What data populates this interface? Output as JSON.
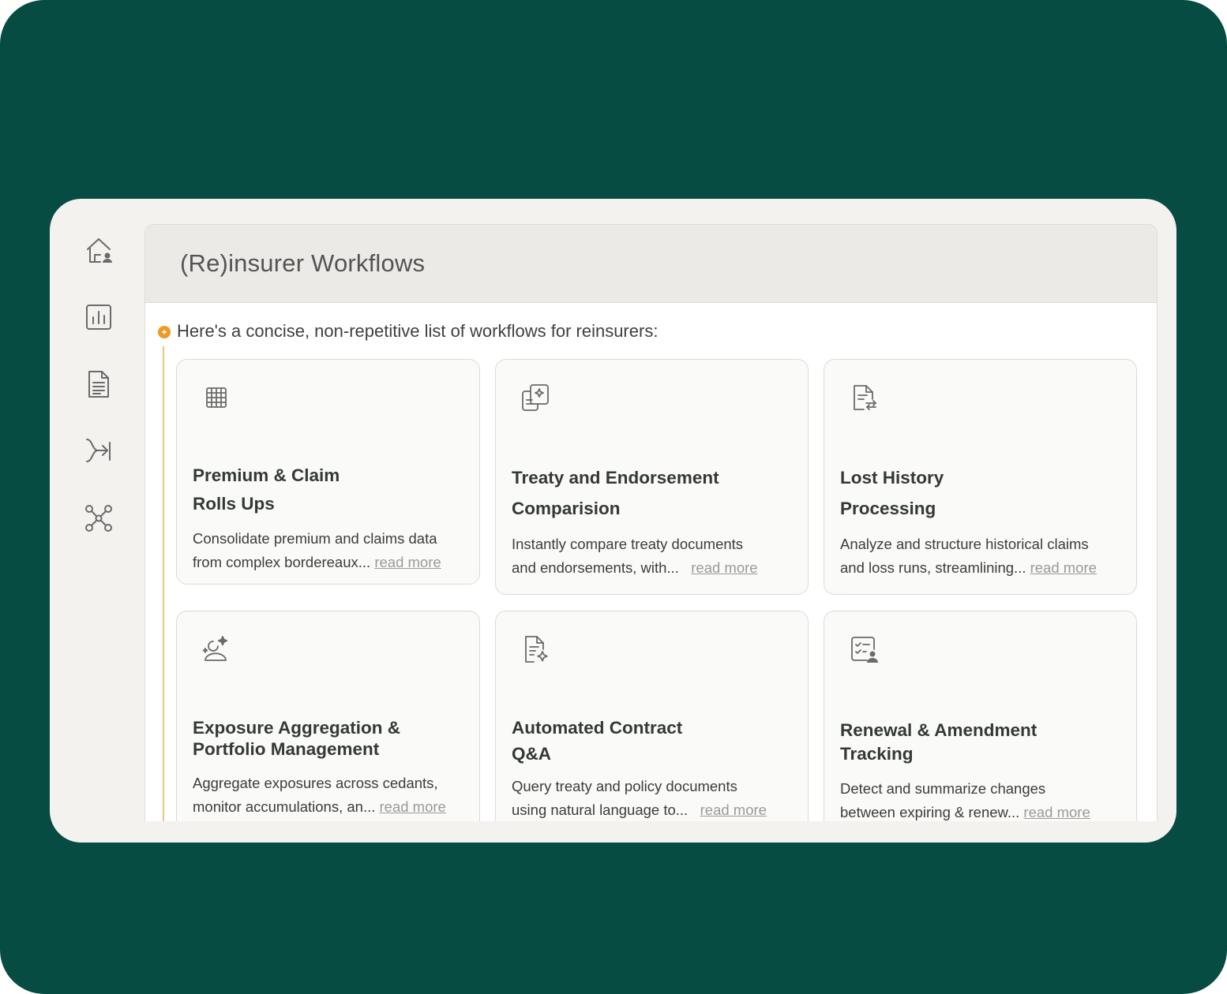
{
  "sidebar": {
    "items": [
      {
        "icon": "home-user-icon"
      },
      {
        "icon": "bar-chart-icon"
      },
      {
        "icon": "document-icon"
      },
      {
        "icon": "route-arrow-icon"
      },
      {
        "icon": "network-icon"
      }
    ]
  },
  "header": {
    "title": "(Re)insurer Workflows"
  },
  "intro": {
    "text": "Here's a concise, non-repetitive list of workflows for reinsurers:"
  },
  "colors": {
    "accent": "#ef9a22",
    "background": "#074c42"
  },
  "cards": [
    {
      "icon": "table-grid-icon",
      "title_line1": "Premium & Claim",
      "title_line2": "Rolls Ups",
      "desc_line1": "Consolidate premium and claims data",
      "desc_line2": "from complex bordereaux...",
      "read_more": "read more"
    },
    {
      "icon": "document-compare-sparkle-icon",
      "title_line1": "Treaty and Endorsement",
      "title_line2": "Comparision",
      "desc_line1": "Instantly compare treaty documents",
      "desc_line2": "and endorsements, with...",
      "read_more": "read more"
    },
    {
      "icon": "document-return-icon",
      "title_line1": "Lost History",
      "title_line2": "Processing",
      "desc_line1": "Analyze and structure historical claims",
      "desc_line2": "and loss runs, streamlining...",
      "read_more": "read more"
    },
    {
      "icon": "user-sparkle-icon",
      "title_line1": "Exposure Aggregation &",
      "title_line2": "Portfolio Management",
      "desc_line1": "Aggregate exposures across cedants,",
      "desc_line2": "monitor accumulations, an...",
      "read_more": "read more"
    },
    {
      "icon": "document-sparkle-icon",
      "title_line1": "Automated Contract",
      "title_line2": "Q&A",
      "desc_line1": "Query treaty and policy documents",
      "desc_line2": "using natural language to...",
      "read_more": "read more"
    },
    {
      "icon": "checklist-user-icon",
      "title_line1": "Renewal & Amendment",
      "title_line2": "Tracking",
      "desc_line1": "Detect and summarize changes",
      "desc_line2": "between expiring & renew...",
      "read_more": "read more"
    }
  ]
}
